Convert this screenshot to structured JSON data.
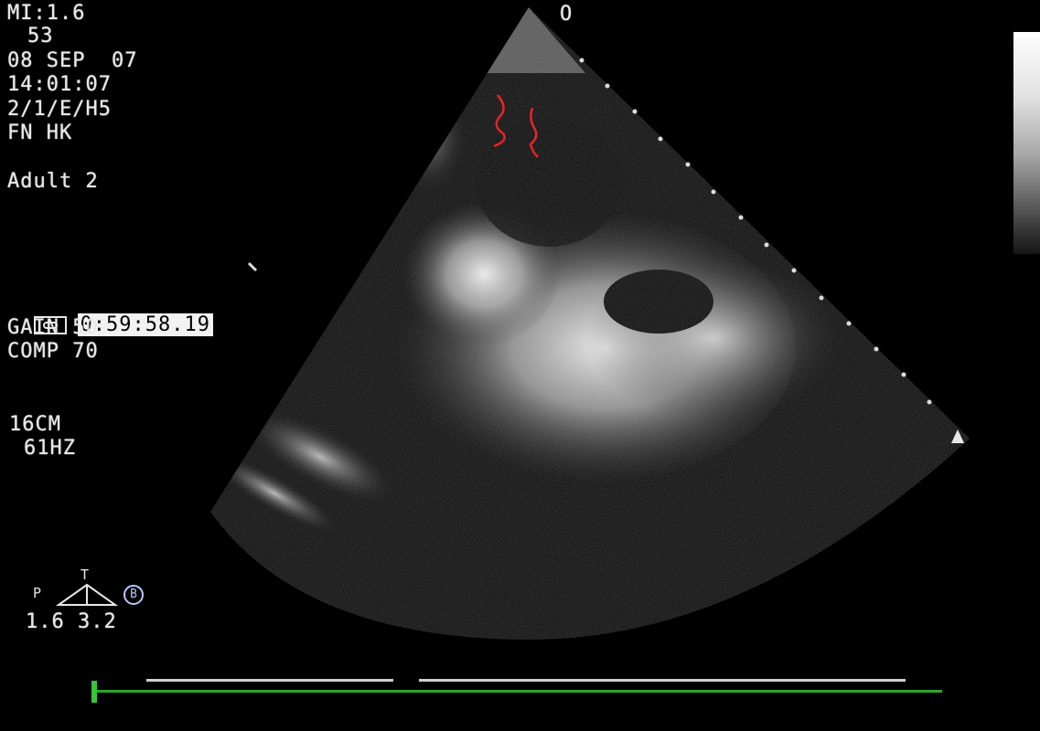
{
  "overlay": {
    "mi": "MI:1.6",
    "line2": "53",
    "date": "08 SEP  07",
    "time": "14:01:07",
    "mode": "2/1/E/H5",
    "operator": "FN HK",
    "preset": "Adult 2",
    "cine_time": "0:59:58.19",
    "gain": "GAIN 50",
    "comp": "COMP 70",
    "depth": "16CM",
    "frame_rate": "61HZ",
    "orientation_marker": "O",
    "probe_p": "P",
    "probe_t": "T",
    "probe_mode": "B",
    "probe_values": "1.6 3.2"
  },
  "colors": {
    "annotation": "#e8232a",
    "timeline": "#2ba82b"
  },
  "cine": {
    "progress": 0.0
  }
}
